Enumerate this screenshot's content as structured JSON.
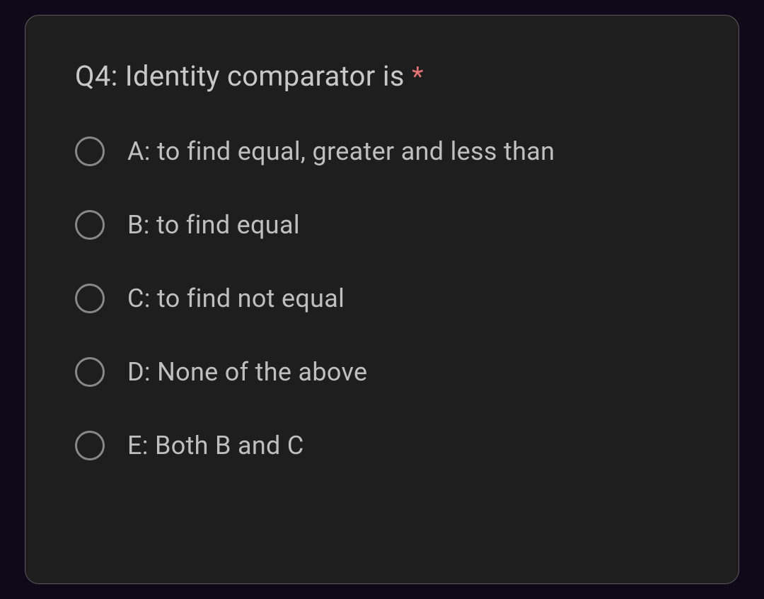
{
  "question": {
    "title": "Q4: Identity comparator is ",
    "required_marker": "*",
    "options": [
      {
        "label": "A: to find equal, greater and less than"
      },
      {
        "label": "B: to find equal"
      },
      {
        "label": "C: to find not equal"
      },
      {
        "label": "D: None of the above"
      },
      {
        "label": "E: Both B and C"
      }
    ]
  }
}
